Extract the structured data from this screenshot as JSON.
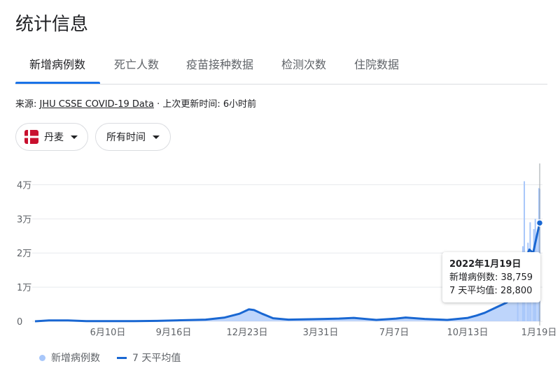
{
  "page": {
    "title": "统计信息"
  },
  "tabs": [
    {
      "label": "新增病例数",
      "active": true
    },
    {
      "label": "死亡人数",
      "active": false
    },
    {
      "label": "疫苗接种数据",
      "active": false
    },
    {
      "label": "检测次数",
      "active": false
    },
    {
      "label": "住院数据",
      "active": false
    }
  ],
  "source": {
    "prefix": "来源:",
    "link": "JHU CSSE COVID-19 Data",
    "separator": "·",
    "updated": "上次更新时间: 6小时前"
  },
  "filters": {
    "region": "丹麦",
    "region_flag": "denmark-flag",
    "time_range": "所有时间"
  },
  "tooltip": {
    "date": "2022年1月19日",
    "new_cases_label": "新增病例数:",
    "new_cases_value": "38,759",
    "avg_label": "7 天平均值:",
    "avg_value": "28,800"
  },
  "legend": {
    "daily_label": "新增病例数",
    "average_label": "7 天平均值"
  },
  "colors": {
    "accent": "#1a73e8",
    "average_line": "#1967d2",
    "daily_fill": "#a8c7fa",
    "gridline": "#e8eaed"
  },
  "chart_data": {
    "type": "line",
    "y_ticks": [
      {
        "value": 0,
        "label": "0"
      },
      {
        "value": 10000,
        "label": "1万"
      },
      {
        "value": 20000,
        "label": "2万"
      },
      {
        "value": 30000,
        "label": "3万"
      },
      {
        "value": 40000,
        "label": "4万"
      }
    ],
    "ylim": [
      0,
      45000
    ],
    "x_ticks": [
      "6月10日",
      "9月16日",
      "12月23日",
      "3月31日",
      "7月7日",
      "10月13日",
      "1月19日"
    ],
    "x_range": [
      "2020-03-01",
      "2022-01-19"
    ],
    "series": [
      {
        "name": "7 天平均值",
        "points": [
          [
            "2020-03-01",
            0
          ],
          [
            "2020-03-20",
            250
          ],
          [
            "2020-04-15",
            250
          ],
          [
            "2020-05-10",
            60
          ],
          [
            "2020-06-10",
            50
          ],
          [
            "2020-07-15",
            50
          ],
          [
            "2020-08-15",
            120
          ],
          [
            "2020-09-16",
            300
          ],
          [
            "2020-10-20",
            500
          ],
          [
            "2020-11-15",
            1100
          ],
          [
            "2020-12-05",
            2200
          ],
          [
            "2020-12-18",
            3500
          ],
          [
            "2020-12-25",
            3300
          ],
          [
            "2021-01-05",
            2200
          ],
          [
            "2021-01-20",
            900
          ],
          [
            "2021-02-10",
            500
          ],
          [
            "2021-03-31",
            700
          ],
          [
            "2021-04-20",
            800
          ],
          [
            "2021-05-10",
            1000
          ],
          [
            "2021-06-10",
            400
          ],
          [
            "2021-07-07",
            800
          ],
          [
            "2021-07-20",
            1100
          ],
          [
            "2021-08-15",
            700
          ],
          [
            "2021-09-15",
            400
          ],
          [
            "2021-10-13",
            1000
          ],
          [
            "2021-10-25",
            1700
          ],
          [
            "2021-11-05",
            2500
          ],
          [
            "2021-11-20",
            4000
          ],
          [
            "2021-12-05",
            5500
          ],
          [
            "2021-12-15",
            8500
          ],
          [
            "2021-12-25",
            13000
          ],
          [
            "2022-01-01",
            19000
          ],
          [
            "2022-01-05",
            21000
          ],
          [
            "2022-01-10",
            20000
          ],
          [
            "2022-01-14",
            24000
          ],
          [
            "2022-01-19",
            28800
          ]
        ]
      },
      {
        "name": "新增病例数",
        "spikes": [
          [
            "2021-12-20",
            14000
          ],
          [
            "2021-12-27",
            22000
          ],
          [
            "2021-12-29",
            41000
          ],
          [
            "2022-01-03",
            23000
          ],
          [
            "2022-01-06",
            29000
          ],
          [
            "2022-01-11",
            27000
          ],
          [
            "2022-01-13",
            30000
          ],
          [
            "2022-01-18",
            39000
          ],
          [
            "2022-01-19",
            38759
          ]
        ]
      }
    ],
    "highlight": {
      "date": "2022-01-19",
      "value": 28800
    }
  }
}
